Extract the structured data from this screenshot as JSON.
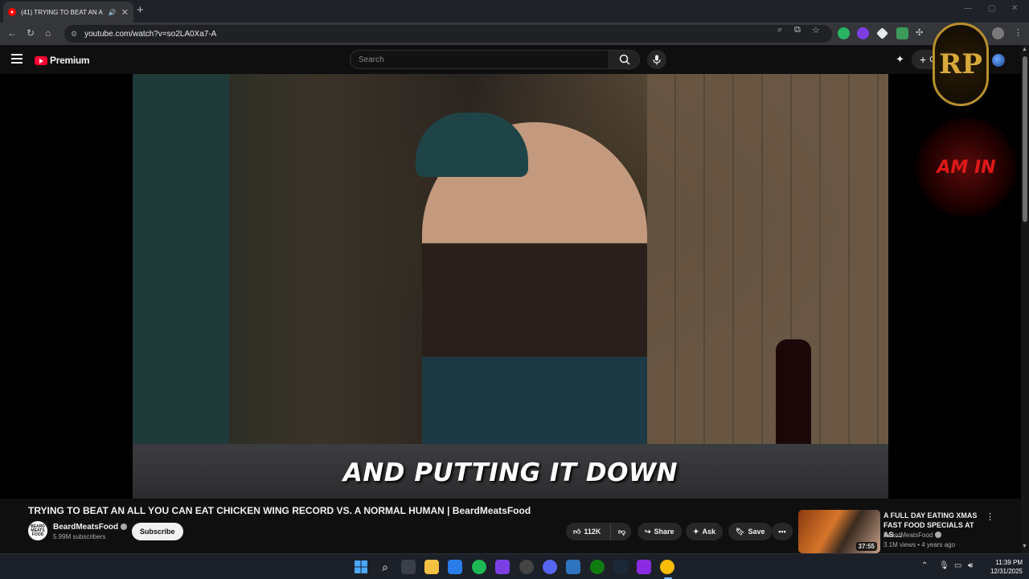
{
  "browser": {
    "tab_title": "(41) TRYING TO BEAT AN A",
    "tab_close": "✕",
    "new_tab": "+",
    "url": "youtube.com/watch?v=so2LA0Xa7-A",
    "window_controls": [
      "—",
      "▢",
      "✕"
    ]
  },
  "youtube": {
    "brand": "Premium",
    "search_placeholder": "Search",
    "create_label": "Cr"
  },
  "video": {
    "caption": "AND PUTTING IT DOWN",
    "overlay_logo_text": "RP",
    "overlay_globe_text": "AM IN"
  },
  "meta": {
    "title": "TRYING TO BEAT AN ALL YOU CAN EAT CHICKEN WING RECORD VS. A NORMAL HUMAN | BeardMeatsFood",
    "channel": "BeardMeatsFood",
    "channel_avatar_text": "BEARD MEATS FOOD",
    "subscribers": "5.99M subscribers",
    "subscribe": "Subscribe",
    "likes": "112K",
    "share": "Share",
    "ask": "Ask",
    "save": "Save",
    "more": "•••"
  },
  "recommendation": {
    "title": "A FULL DAY EATING XMAS FAST FOOD SPECIALS AT AS ...",
    "channel": "BeardMeatsFood",
    "stats": "3.1M views • 4 years ago",
    "duration": "37:55"
  },
  "taskbar": {
    "time": "11:39 PM",
    "date": "12/31/2025"
  },
  "colors": {
    "youtube_red": "#ff0033",
    "page_bg": "#0f0f0f",
    "chrome_tab": "#35363a"
  }
}
